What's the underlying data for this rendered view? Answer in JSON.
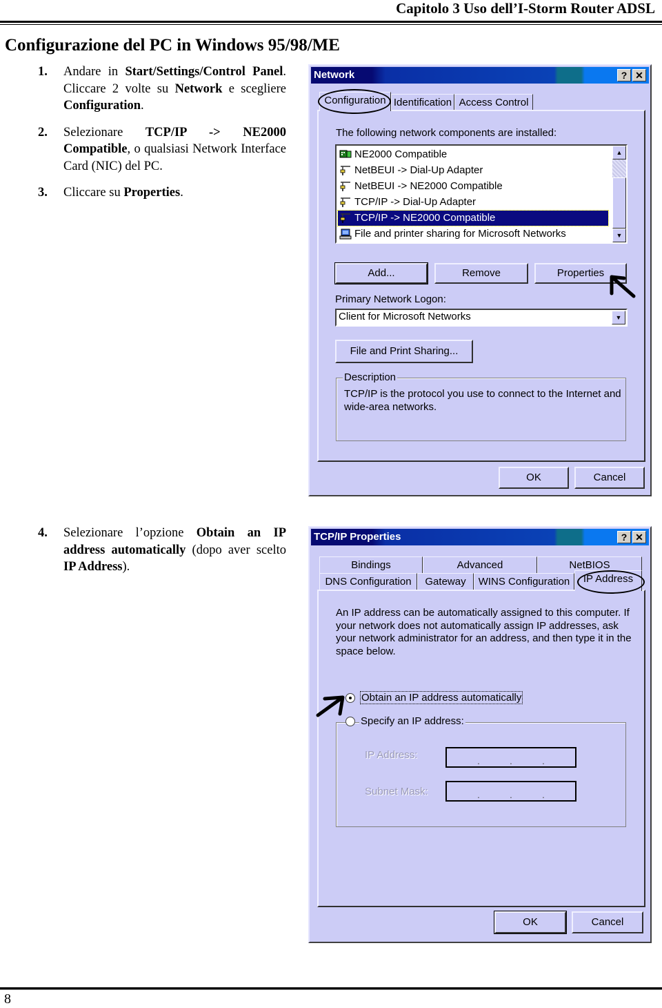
{
  "header": {
    "chapter": "Capitolo  3  Uso dell’I-Storm Router ADSL"
  },
  "section_title": "Configurazione del PC in Windows 95/98/ME",
  "steps_top": [
    {
      "num": "1.",
      "parts": [
        {
          "t": "Andare in ",
          "b": false
        },
        {
          "t": "Start/Settings/Control Panel",
          "b": true
        },
        {
          "t": ". Cliccare 2 volte su ",
          "b": false
        },
        {
          "t": "Network",
          "b": true
        },
        {
          "t": " e scegliere ",
          "b": false
        },
        {
          "t": "Configuration",
          "b": true
        },
        {
          "t": ".",
          "b": false
        }
      ]
    },
    {
      "num": "2.",
      "parts": [
        {
          "t": "Selezionare ",
          "b": false
        },
        {
          "t": "TCP/IP -> NE2000 Compatible",
          "b": true
        },
        {
          "t": ", o qualsiasi Network Interface Card (NIC) del PC.",
          "b": false
        }
      ]
    },
    {
      "num": "3.",
      "parts": [
        {
          "t": "Cliccare su ",
          "b": false
        },
        {
          "t": "Properties",
          "b": true
        },
        {
          "t": ".",
          "b": false
        }
      ]
    }
  ],
  "steps_bottom": [
    {
      "num": "4.",
      "parts": [
        {
          "t": "Selezionare l’opzione ",
          "b": false
        },
        {
          "t": "Obtain an IP address automatically",
          "b": true
        },
        {
          "t": " (dopo aver scelto ",
          "b": false
        },
        {
          "t": "IP Address",
          "b": true
        },
        {
          "t": ").",
          "b": false
        }
      ]
    }
  ],
  "network_dialog": {
    "title": "Network",
    "help_btn": "?",
    "close_btn": "✕",
    "tabs": [
      "Configuration",
      "Identification",
      "Access Control"
    ],
    "active_tab": "Configuration",
    "components_label": "The following network components are installed:",
    "components": [
      {
        "label": "NE2000 Compatible",
        "icon": "network-card-icon"
      },
      {
        "label": "NetBEUI -> Dial-Up Adapter",
        "icon": "protocol-icon"
      },
      {
        "label": "NetBEUI -> NE2000 Compatible",
        "icon": "protocol-icon"
      },
      {
        "label": "TCP/IP -> Dial-Up Adapter",
        "icon": "protocol-icon"
      },
      {
        "label": "TCP/IP -> NE2000 Compatible",
        "icon": "protocol-icon",
        "selected": true
      },
      {
        "label": "File and printer sharing for Microsoft Networks",
        "icon": "file-sharing-icon"
      }
    ],
    "buttons": {
      "add": "Add...",
      "remove": "Remove",
      "properties": "Properties"
    },
    "logon_label": "Primary Network Logon:",
    "logon_value": "Client for Microsoft Networks",
    "file_print_sharing": "File and Print Sharing...",
    "description_title": "Description",
    "description_text": "TCP/IP is the protocol you use to connect to the Internet and wide-area networks.",
    "ok": "OK",
    "cancel": "Cancel",
    "accent_colors": {
      "title_dark": "#060a72",
      "title_light": "#0a78f0",
      "face": "#ccccf6",
      "selection": "#0a0a80"
    }
  },
  "tcpip_dialog": {
    "title": "TCP/IP Properties",
    "help_btn": "?",
    "close_btn": "✕",
    "tabs_row1": [
      "Bindings",
      "Advanced",
      "NetBIOS"
    ],
    "tabs_row2": [
      "DNS Configuration",
      "Gateway",
      "WINS Configuration",
      "IP Address"
    ],
    "active_tab": "IP Address",
    "intro_text": "An IP address can be automatically assigned to this computer. If your network does not automatically assign IP addresses, ask your network administrator for an address, and then type it in the space below.",
    "radio_obtain": "Obtain an IP address automatically",
    "radio_obtain_selected": true,
    "radio_specify": "Specify an IP address:",
    "radio_specify_selected": false,
    "ip_address_label": "IP Address:",
    "subnet_mask_label": "Subnet Mask:",
    "ip_address_value": "",
    "subnet_mask_value": "",
    "ok": "OK",
    "cancel": "Cancel"
  },
  "footer": {
    "page_number": "8"
  }
}
